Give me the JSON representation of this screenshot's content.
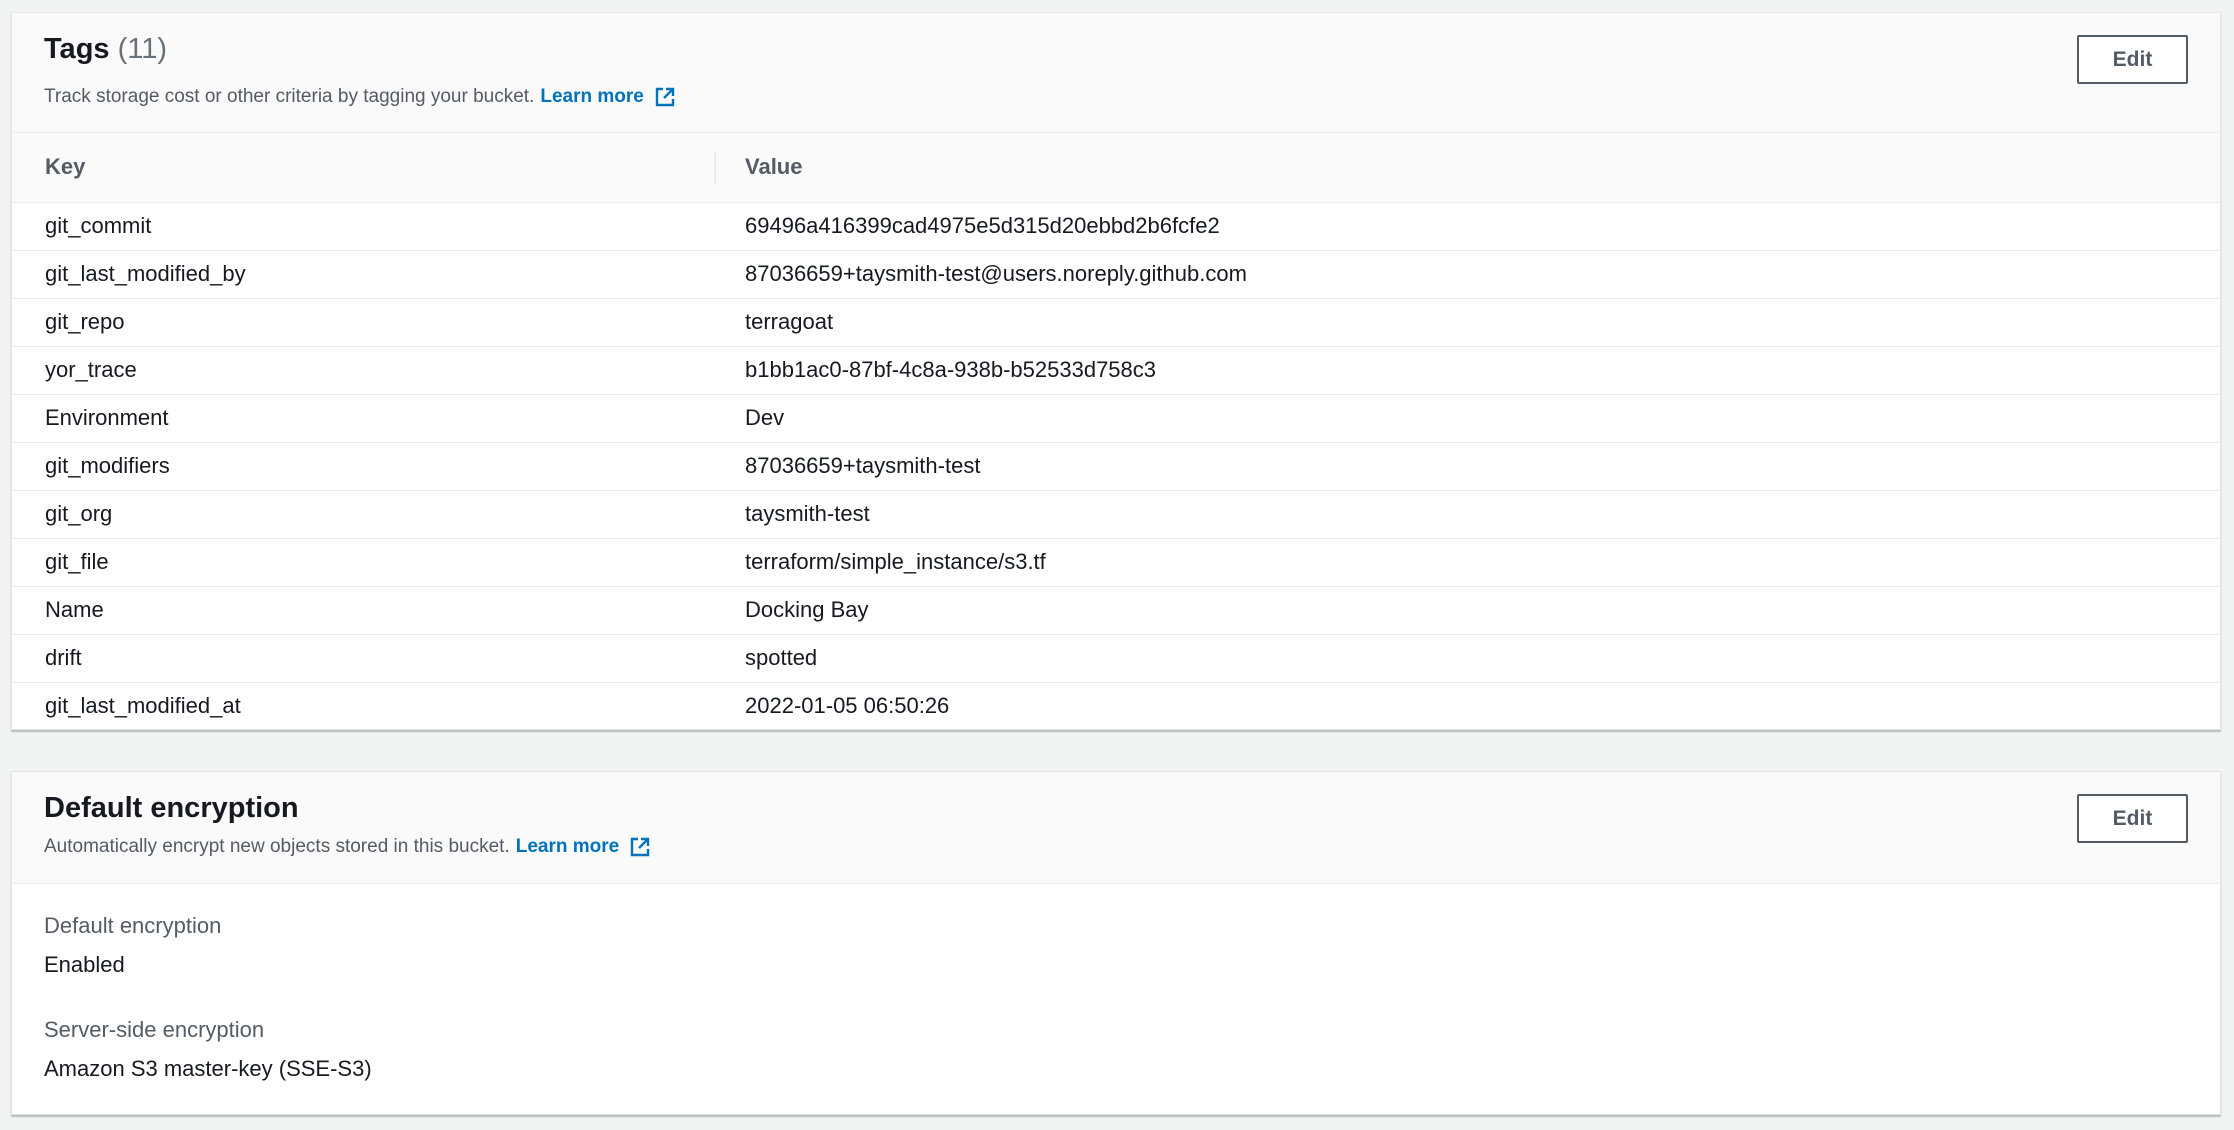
{
  "tags": {
    "title": "Tags",
    "count": "(11)",
    "description": "Track storage cost or other criteria by tagging your bucket.",
    "learn_more": "Learn more",
    "edit_label": "Edit",
    "columns": {
      "key": "Key",
      "value": "Value"
    },
    "rows": [
      {
        "key": "git_commit",
        "value": "69496a416399cad4975e5d315d20ebbd2b6fcfe2"
      },
      {
        "key": "git_last_modified_by",
        "value": "87036659+taysmith-test@users.noreply.github.com"
      },
      {
        "key": "git_repo",
        "value": "terragoat"
      },
      {
        "key": "yor_trace",
        "value": "b1bb1ac0-87bf-4c8a-938b-b52533d758c3"
      },
      {
        "key": "Environment",
        "value": "Dev"
      },
      {
        "key": "git_modifiers",
        "value": "87036659+taysmith-test"
      },
      {
        "key": "git_org",
        "value": "taysmith-test"
      },
      {
        "key": "git_file",
        "value": "terraform/simple_instance/s3.tf"
      },
      {
        "key": "Name",
        "value": "Docking Bay"
      },
      {
        "key": "drift",
        "value": "spotted"
      },
      {
        "key": "git_last_modified_at",
        "value": "2022-01-05 06:50:26"
      }
    ]
  },
  "encryption": {
    "title": "Default encryption",
    "description": "Automatically encrypt new objects stored in this bucket.",
    "learn_more": "Learn more",
    "edit_label": "Edit",
    "fields": [
      {
        "label": "Default encryption",
        "value": "Enabled"
      },
      {
        "label": "Server-side encryption",
        "value": "Amazon S3 master-key (SSE-S3)"
      }
    ]
  },
  "icons": {
    "external_link": "external-link-icon"
  },
  "colors": {
    "link": "#0073bb",
    "text": "#16191f",
    "muted": "#545b64"
  }
}
